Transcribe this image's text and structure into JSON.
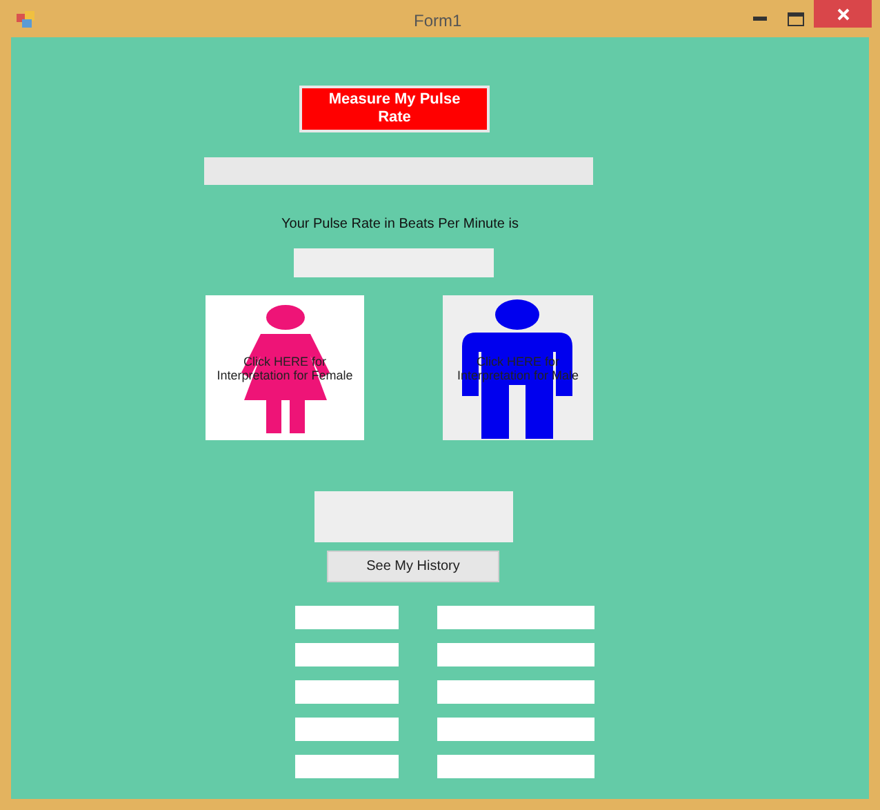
{
  "window": {
    "title": "Form1"
  },
  "measure_button": "Measure My Pulse Rate",
  "result_label": "Your Pulse Rate in Beats Per Minute is",
  "figure_buttons": [
    {
      "kind": "female",
      "label": "Click HERE for Interpretation for Female"
    },
    {
      "kind": "male",
      "label": "Click HERE for Interpretation for Male"
    }
  ],
  "history_button": "See My History"
}
